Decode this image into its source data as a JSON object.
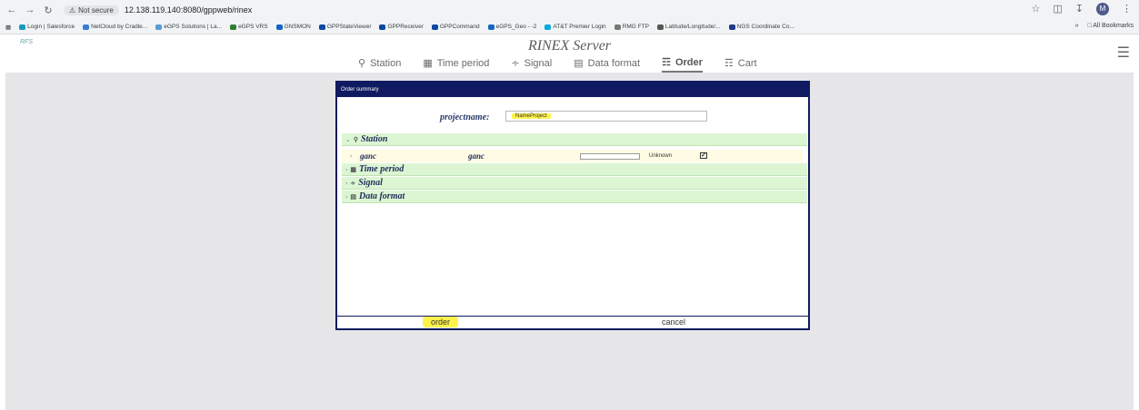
{
  "browser": {
    "security_label": "Not secure",
    "url": "12.138.119.140:8080/gppweb/rinex",
    "profile_initial": "M",
    "bookmarks": [
      "Login | Salesforce",
      "NetCloud by Cradle...",
      "eGPS Solutions | La...",
      "eGPS VRS",
      "GNSMON",
      "GPPStateViewer",
      "GPPReceiver",
      "GPPCommand",
      "eGPS_Geo - -2",
      "AT&T Premier Login",
      "RMG FTP",
      "Latitude/Longitude/...",
      "NGS Coordinate Co..."
    ],
    "all_bookmarks": "All Bookmarks"
  },
  "app": {
    "logo": "RFS",
    "title": "RINEX Server",
    "tabs": [
      {
        "label": "Station",
        "icon": "marker-icon"
      },
      {
        "label": "Time period",
        "icon": "calendar-icon"
      },
      {
        "label": "Signal",
        "icon": "signal-icon"
      },
      {
        "label": "Data format",
        "icon": "file-icon"
      },
      {
        "label": "Order",
        "icon": "order-icon",
        "active": true
      },
      {
        "label": "Cart",
        "icon": "cart-icon"
      }
    ]
  },
  "dialog": {
    "title": "Order summary",
    "project_label": "projectname:",
    "project_value": "NameProject",
    "sections": {
      "station": "Station",
      "time_period": "Time period",
      "signal": "Signal",
      "data_format": "Data format"
    },
    "station_row": {
      "name": "ganc",
      "name2": "ganc",
      "status": "Unknown",
      "checked": true
    },
    "order_label": "order",
    "cancel_label": "cancel"
  },
  "colors": {
    "dialog_header": "#101a60",
    "section_bg": "#dcf6d4",
    "highlight": "#fff34a",
    "main_bg": "#e6e6e8"
  }
}
